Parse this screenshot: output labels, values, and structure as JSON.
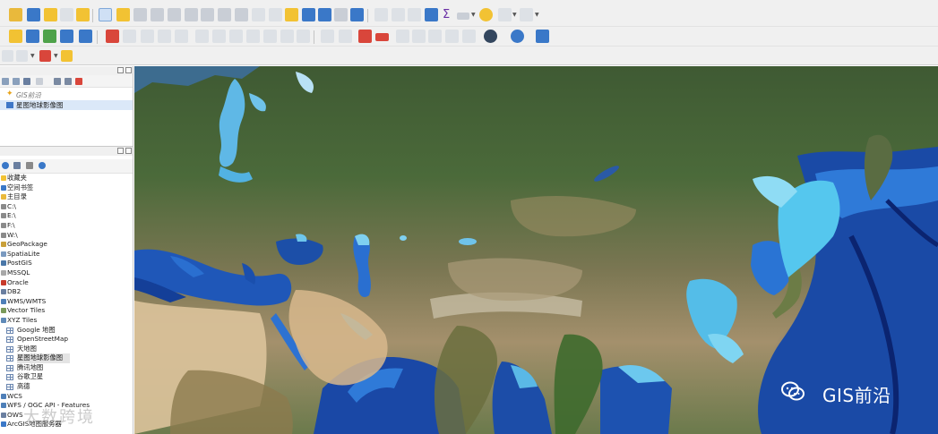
{
  "layers_panel": {
    "items": [
      {
        "label": "GIS前沿",
        "icon": "xyz-star-icon"
      },
      {
        "label": "星图地球影像图",
        "icon": "raster-layer-icon"
      }
    ]
  },
  "browser_panel": {
    "items": [
      {
        "label": "收藏夹",
        "icon": "star-icon",
        "level": 0
      },
      {
        "label": "空间书签",
        "icon": "bookmark-icon",
        "level": 0
      },
      {
        "label": "主目录",
        "icon": "folder-icon",
        "level": 0
      },
      {
        "label": "C:\\",
        "icon": "drive-icon",
        "level": 0
      },
      {
        "label": "E:\\",
        "icon": "drive-icon",
        "level": 0
      },
      {
        "label": "F:\\",
        "icon": "drive-icon",
        "level": 0
      },
      {
        "label": "W:\\",
        "icon": "drive-icon",
        "level": 0
      },
      {
        "label": "GeoPackage",
        "icon": "geopackage-icon",
        "level": 0
      },
      {
        "label": "SpatiaLite",
        "icon": "spatialite-icon",
        "level": 0
      },
      {
        "label": "PostGIS",
        "icon": "postgis-icon",
        "level": 0
      },
      {
        "label": "MSSQL",
        "icon": "mssql-icon",
        "level": 0
      },
      {
        "label": "Oracle",
        "icon": "oracle-icon",
        "level": 0
      },
      {
        "label": "DB2",
        "icon": "db2-icon",
        "level": 0
      },
      {
        "label": "WMS/WMTS",
        "icon": "wms-icon",
        "level": 0
      },
      {
        "label": "Vector Tiles",
        "icon": "vector-tiles-icon",
        "level": 0
      },
      {
        "label": "XYZ Tiles",
        "icon": "xyz-tiles-icon",
        "level": 0
      },
      {
        "label": "Google 地图",
        "icon": "tile-grid-icon",
        "level": 1
      },
      {
        "label": "OpenStreetMap",
        "icon": "tile-grid-icon",
        "level": 1
      },
      {
        "label": "天地图",
        "icon": "tile-grid-icon",
        "level": 1
      },
      {
        "label": "星图地球影像图",
        "icon": "tile-grid-icon",
        "level": 1,
        "selected": true
      },
      {
        "label": "腾讯地图",
        "icon": "tile-grid-icon",
        "level": 1
      },
      {
        "label": "谷歌卫星",
        "icon": "tile-grid-icon",
        "level": 1
      },
      {
        "label": "高德",
        "icon": "tile-grid-icon",
        "level": 1
      },
      {
        "label": "WCS",
        "icon": "wcs-icon",
        "level": 0
      },
      {
        "label": "WFS / OGC API - Features",
        "icon": "wfs-icon",
        "level": 0
      },
      {
        "label": "OWS",
        "icon": "ows-icon",
        "level": 0
      },
      {
        "label": "ArcGIS地图服务器",
        "icon": "arcgis-icon",
        "level": 0
      }
    ]
  },
  "watermark": {
    "wechat_text": "GIS前沿",
    "left_text": "大数跨境"
  },
  "colors": {
    "toolbar_bg": "#f0f0f0",
    "selection": "#dbe8f8",
    "deep_ocean": "#0f2f86",
    "shallow_sea": "#55c7ee"
  }
}
